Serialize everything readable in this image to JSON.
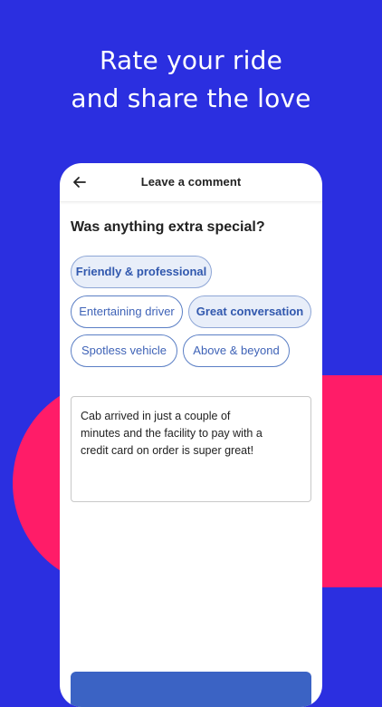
{
  "colors": {
    "background": "#2b2fe0",
    "accent_pink": "#ff1c68",
    "card": "#ffffff",
    "chip_text": "#3f63b7",
    "primary_button": "#3b63c4"
  },
  "headline": {
    "line1": "Rate your ride",
    "line2": "and share the love"
  },
  "screen": {
    "back_icon": "arrow-left-icon",
    "title": "Leave a comment",
    "question": "Was anything extra special?",
    "chips": [
      {
        "label": "Friendly & professional",
        "selected": true
      },
      {
        "label": "Entertaining driver",
        "selected": false
      },
      {
        "label": "Great conversation",
        "selected": true
      },
      {
        "label": "Spotless vehicle",
        "selected": false
      },
      {
        "label": "Above & beyond",
        "selected": false
      }
    ],
    "comment_lines": [
      "Cab arrived in just a couple of",
      "minutes and the facility to pay with a",
      "credit card on order is super great!"
    ]
  }
}
